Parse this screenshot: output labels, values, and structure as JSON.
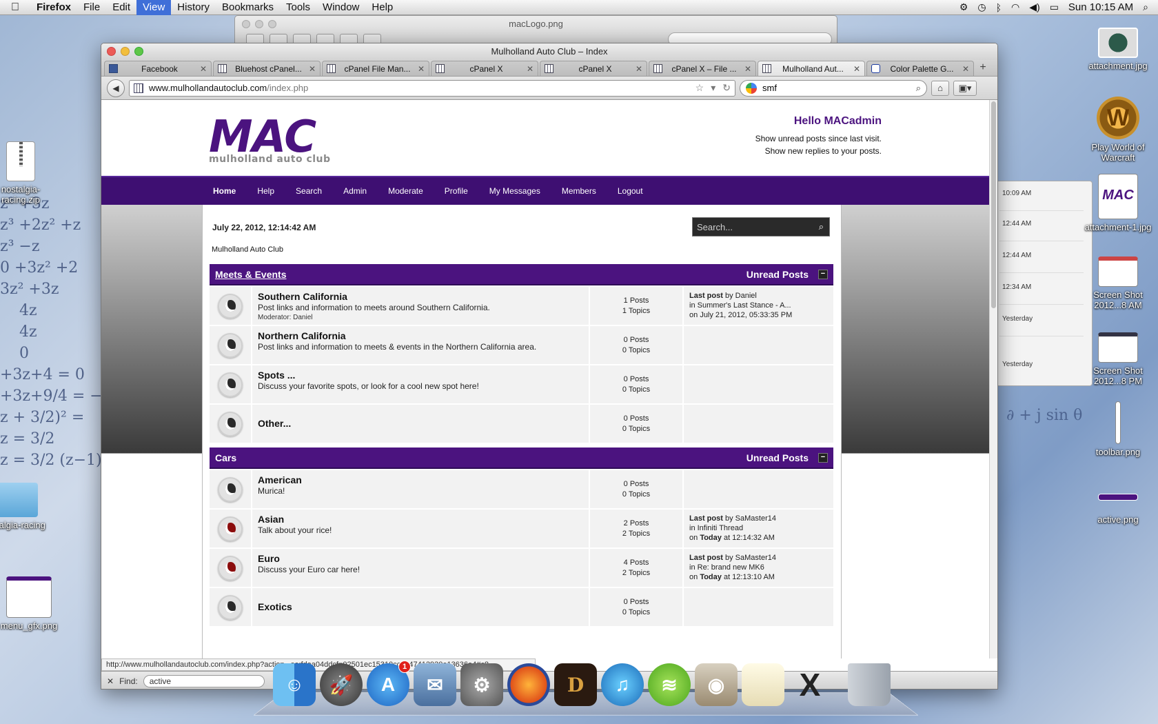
{
  "menubar": {
    "app": "Firefox",
    "items": [
      "File",
      "Edit",
      "View",
      "History",
      "Bookmarks",
      "Tools",
      "Window",
      "Help"
    ],
    "active_item": "View",
    "clock": "Sun 10:15 AM"
  },
  "preview_window": {
    "title": "macLogo.png"
  },
  "chat_window": {
    "times": [
      "10:09 AM",
      "12:44 AM",
      "12:44 AM",
      "12:34 AM",
      "Yesterday",
      "Yesterday"
    ]
  },
  "desktop_icons": {
    "left": [
      {
        "label": "nostalgia-racing.zip",
        "name": "zip-file-icon"
      },
      {
        "label": "nostalgia-racing",
        "name": "folder-icon"
      },
      {
        "label": "menu_gfx.png",
        "name": "image-file-icon"
      }
    ],
    "right": [
      {
        "label": "attachment.jpg",
        "name": "image-file-icon"
      },
      {
        "label": "Play World of Warcraft",
        "name": "warcraft-app-icon"
      },
      {
        "label": "attachment-1.jpg",
        "name": "image-file-icon"
      },
      {
        "label": "Screen Shot 2012...8 AM",
        "name": "screenshot-file-icon"
      },
      {
        "label": "Screen Shot 2012...8 PM",
        "name": "screenshot-file-icon"
      },
      {
        "label": "toolbar.png",
        "name": "image-file-icon"
      },
      {
        "label": "active.png",
        "name": "image-file-icon"
      }
    ]
  },
  "browser": {
    "window_title": "Mulholland Auto Club – Index",
    "tabs": [
      {
        "label": "Facebook",
        "icon": "facebook-icon"
      },
      {
        "label": "Bluehost cPanel...",
        "icon": "cpanel-icon"
      },
      {
        "label": "cPanel File Man...",
        "icon": "cpanel-icon"
      },
      {
        "label": "cPanel X",
        "icon": "cpanel-icon"
      },
      {
        "label": "cPanel X",
        "icon": "cpanel-icon"
      },
      {
        "label": "cPanel X – File ...",
        "icon": "cpanel-icon"
      },
      {
        "label": "Mulholland Aut...",
        "icon": "page-icon",
        "active": true
      },
      {
        "label": "Color Palette G...",
        "icon": "palette-icon"
      }
    ],
    "url_domain": "www.mulhollandautoclub.com",
    "url_path": "/index.php",
    "search_value": "smf",
    "status_url": "http://www.mulhollandautoclub.com/index.php?action...se;fdaa04ddcf=02501ec15310cc3047412930e13636e4#c8",
    "find_label": "Find:",
    "find_value": "active"
  },
  "site": {
    "logo_big": "MAC",
    "logo_small": "mulholland auto club",
    "hello": "Hello MACadmin",
    "links": [
      "Show unread posts since last visit.",
      "Show new replies to your posts."
    ],
    "nav": [
      "Home",
      "Help",
      "Search",
      "Admin",
      "Moderate",
      "Profile",
      "My Messages",
      "Members",
      "Logout"
    ],
    "date": "July 22, 2012, 12:14:42 AM",
    "search_placeholder": "Search...",
    "linktree": "Mulholland Auto Club",
    "categories": [
      {
        "title": "Meets & Events",
        "unread": "Unread Posts",
        "boards": [
          {
            "name": "Southern California",
            "desc": "Post links and information to meets around Southern California.",
            "moderator_label": "Moderator:",
            "moderator": "Daniel",
            "posts": "1 Posts",
            "topics": "1 Topics",
            "last_by": "Daniel",
            "last_in": "Summer's Last Stance - A...",
            "last_on": "July 21, 2012, 05:33:35 PM",
            "new": false
          },
          {
            "name": "Northern California",
            "desc": "Post links and information to meets & events in the Northern California area.",
            "posts": "0 Posts",
            "topics": "0 Topics",
            "new": false
          },
          {
            "name": "Spots ...",
            "desc": "Discuss your favorite spots, or look for a cool new spot here!",
            "posts": "0 Posts",
            "topics": "0 Topics",
            "new": false
          },
          {
            "name": "Other...",
            "desc": "",
            "posts": "0 Posts",
            "topics": "0 Topics",
            "new": false
          }
        ]
      },
      {
        "title": "Cars",
        "unread": "Unread Posts",
        "boards": [
          {
            "name": "American",
            "desc": "Murica!",
            "posts": "0 Posts",
            "topics": "0 Topics",
            "new": false
          },
          {
            "name": "Asian",
            "desc": "Talk about your rice!",
            "posts": "2 Posts",
            "topics": "2 Topics",
            "last_by": "SaMaster14",
            "last_in": "Infiniti Thread",
            "last_on_bold": "Today",
            "last_on_rest": "at 12:14:32 AM",
            "new": true
          },
          {
            "name": "Euro",
            "desc": "Discuss your Euro car here!",
            "posts": "4 Posts",
            "topics": "2 Topics",
            "last_by": "SaMaster14",
            "last_in": "Re: brand new MK6",
            "last_on_bold": "Today",
            "last_on_rest": "at 12:13:10 AM",
            "new": true
          },
          {
            "name": "Exotics",
            "desc": "",
            "posts": "0 Posts",
            "topics": "0 Topics",
            "new": false
          }
        ]
      }
    ],
    "last_post_label": "Last post",
    "by_label": "by",
    "in_label": "in",
    "on_label": "on"
  },
  "colors": {
    "brand_purple": "#4b137f",
    "nav_purple": "#3e0f72"
  }
}
